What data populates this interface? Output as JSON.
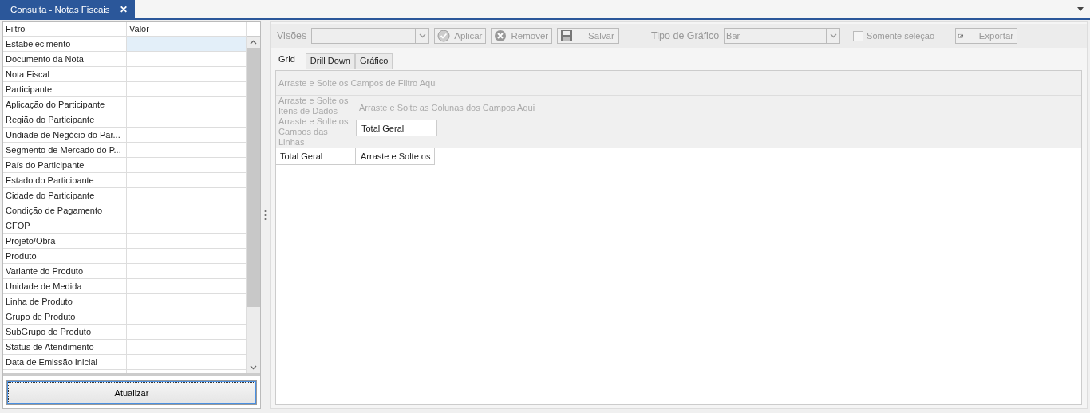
{
  "doc_tab": {
    "title": "Consulta - Notas Fiscais",
    "close": "✕"
  },
  "filter_grid": {
    "columns": [
      "Filtro",
      "Valor"
    ],
    "rows": [
      {
        "filter": "Estabelecimento",
        "selected": true
      },
      {
        "filter": "Documento da Nota",
        "selected": false
      },
      {
        "filter": "Nota Fiscal",
        "selected": false
      },
      {
        "filter": "Participante",
        "selected": false
      },
      {
        "filter": "Aplicação do Participante",
        "selected": false
      },
      {
        "filter": "Região do Participante",
        "selected": false
      },
      {
        "filter": "Undiade de Negócio do Par...",
        "selected": false
      },
      {
        "filter": "Segmento de Mercado do P...",
        "selected": false
      },
      {
        "filter": "País do Participante",
        "selected": false
      },
      {
        "filter": "Estado do Participante",
        "selected": false
      },
      {
        "filter": "Cidade do Participante",
        "selected": false
      },
      {
        "filter": "Condição de Pagamento",
        "selected": false
      },
      {
        "filter": "CFOP",
        "selected": false
      },
      {
        "filter": "Projeto/Obra",
        "selected": false
      },
      {
        "filter": "Produto",
        "selected": false
      },
      {
        "filter": "Variante do Produto",
        "selected": false
      },
      {
        "filter": "Unidade de Medida",
        "selected": false
      },
      {
        "filter": "Linha de Produto",
        "selected": false
      },
      {
        "filter": "Grupo de Produto",
        "selected": false
      },
      {
        "filter": "SubGrupo de Produto",
        "selected": false
      },
      {
        "filter": "Status de Atendimento",
        "selected": false
      },
      {
        "filter": "Data de Emissão Inicial",
        "selected": false
      }
    ],
    "refresh_button": "Atualizar"
  },
  "toolbar": {
    "views_label": "Visões",
    "apply": "Aplicar",
    "remove": "Remover",
    "save": "Salvar",
    "chart_type_label": "Tipo de Gráfico",
    "chart_type": "Bar",
    "selection_only": {
      "label": "Somente seleção",
      "checked": false
    },
    "export": "Exportar",
    "disabled": true
  },
  "tabs": [
    {
      "label": "Grid",
      "selected": true
    },
    {
      "label": "Drill Down",
      "selected": false
    },
    {
      "label": "Gráfico",
      "selected": false
    }
  ],
  "pivot": {
    "filter_area": "Arraste e Solte os Campos de Filtro Aqui",
    "data_area": "Arraste e Solte os Itens de Dados",
    "column_area": "Arraste e Solte as Colunas dos Campos Aqui",
    "row_area": "Arraste e Solte os Campos das Linhas",
    "column_total": "Total Geral",
    "row_total": "Total Geral",
    "data_cell": "Arraste e Solte os"
  }
}
